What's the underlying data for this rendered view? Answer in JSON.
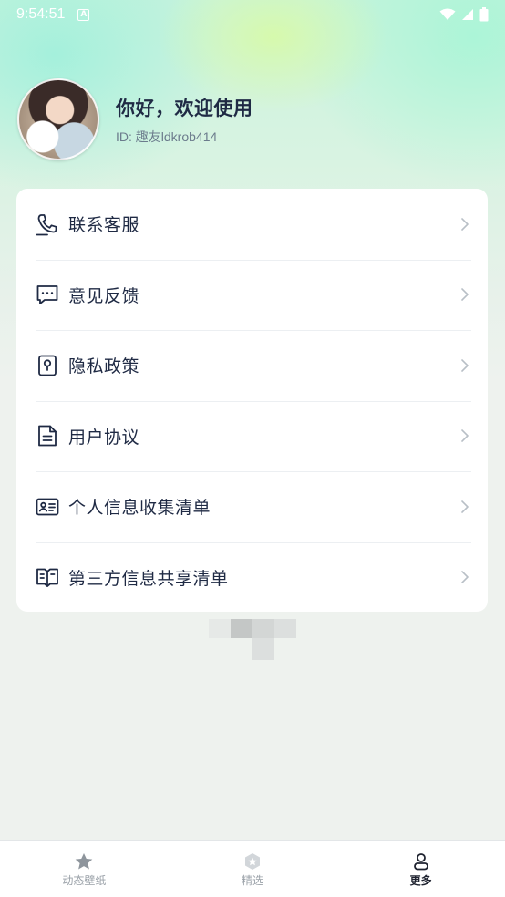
{
  "status_bar": {
    "time": "9:54:51",
    "notification_icon": "a-icon",
    "right_icons": [
      "wifi-icon",
      "signal-icon",
      "battery-icon"
    ]
  },
  "profile": {
    "greeting": "你好，欢迎使用",
    "user_id": "ID: 趣友ldkrob414",
    "avatar": "anime-girl-with-white-cat"
  },
  "menu": {
    "items": [
      {
        "label": "联系客服",
        "icon": "phone-icon"
      },
      {
        "label": "意见反馈",
        "icon": "chat-icon"
      },
      {
        "label": "隐私政策",
        "icon": "privacy-lock-icon"
      },
      {
        "label": "用户协议",
        "icon": "document-icon"
      },
      {
        "label": "个人信息收集清单",
        "icon": "id-card-icon"
      },
      {
        "label": "第三方信息共享清单",
        "icon": "book-list-icon"
      }
    ]
  },
  "tabbar": {
    "tabs": [
      {
        "label": "动态壁纸",
        "icon": "star-icon",
        "active": false
      },
      {
        "label": "精选",
        "icon": "hexagon-star-icon",
        "active": false
      },
      {
        "label": "更多",
        "icon": "user-icon",
        "active": true
      }
    ]
  },
  "colors": {
    "text_primary": "#1f2a44",
    "text_secondary": "#6b7b8c",
    "tab_inactive": "#9aa1a8",
    "tab_active": "#1f2330",
    "card_bg": "#ffffff",
    "page_bg": "#eef2ee"
  }
}
